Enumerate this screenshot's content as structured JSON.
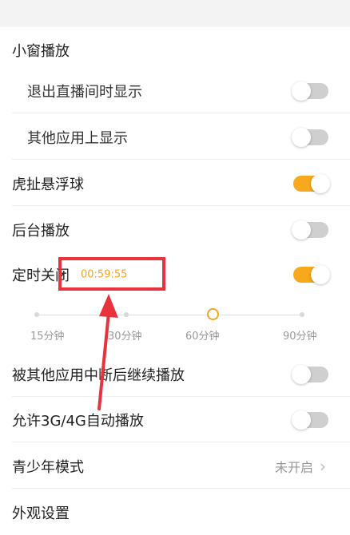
{
  "settings": {
    "mini_window": {
      "title": "小窗播放"
    },
    "exit_live_show": {
      "label": "退出直播间时显示",
      "on": false
    },
    "other_app_show": {
      "label": "其他应用上显示",
      "on": false
    },
    "floating_ball": {
      "label": "虎扯悬浮球",
      "on": true
    },
    "background_play": {
      "label": "后台播放",
      "on": false
    },
    "timer_close": {
      "label": "定时关闭",
      "on": true,
      "countdown": "00:59:55"
    },
    "timer_slider": {
      "options": [
        "15分钟",
        "30分钟",
        "60分钟",
        "90分钟"
      ],
      "selected": "60分钟"
    },
    "continue_after_interrupt": {
      "label": "被其他应用中断后继续播放",
      "on": false
    },
    "autoplay_3g4g": {
      "label": "允许3G/4G自动播放",
      "on": false
    },
    "youth_mode": {
      "label": "青少年模式",
      "value": "未开启"
    },
    "appearance": {
      "label": "外观设置"
    }
  },
  "colors": {
    "accent": "#f7a81c",
    "highlight": "#e8333d"
  }
}
